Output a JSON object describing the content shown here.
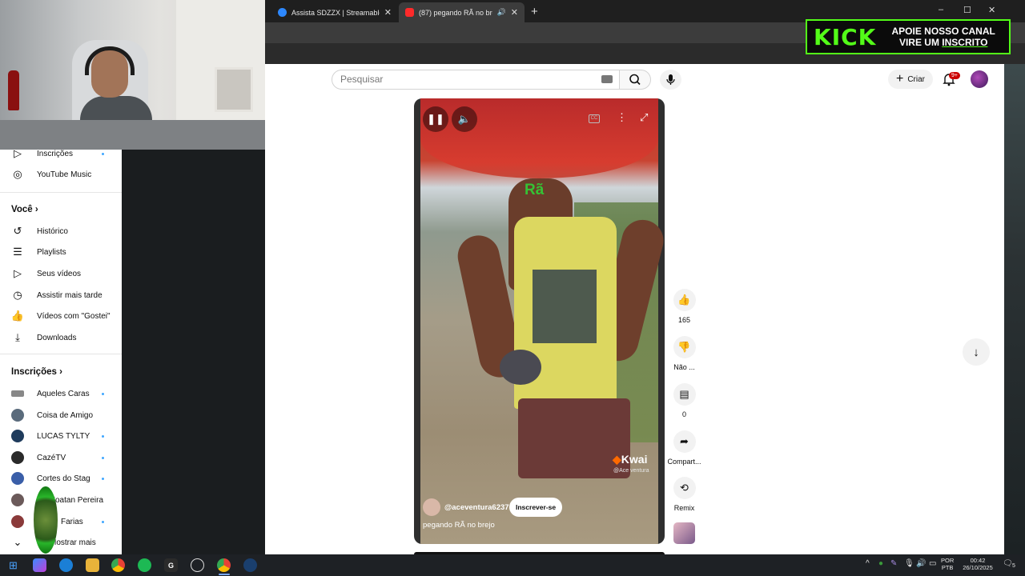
{
  "browser": {
    "tabs": [
      {
        "title": "Assista SDZZX | Streamable",
        "active": false
      },
      {
        "title": "(87) pegando RÃ no brejo",
        "active": true
      }
    ],
    "new_tab": "+",
    "window_controls": [
      "–",
      "☐",
      "✕"
    ]
  },
  "kick_banner": {
    "logo": "KICK",
    "line1": "APOIE NOSSO CANAL",
    "line2_a": "VIRE UM ",
    "line2_b": "INSCRITO",
    "accent": "#53fc18"
  },
  "header": {
    "search_placeholder": "Pesquisar",
    "create_label": "Criar",
    "notification_count": "9+"
  },
  "sidebar": {
    "top_items": [
      {
        "label": "Inscrições",
        "icon": "subscriptions-icon",
        "dot": true
      },
      {
        "label": "YouTube Music",
        "icon": "music-icon",
        "dot": false
      }
    ],
    "you_heading": "Você",
    "you_items": [
      {
        "label": "Histórico",
        "icon": "history-icon"
      },
      {
        "label": "Playlists",
        "icon": "playlist-icon"
      },
      {
        "label": "Seus vídeos",
        "icon": "your-videos-icon"
      },
      {
        "label": "Assistir mais tarde",
        "icon": "clock-icon"
      },
      {
        "label": "Vídeos com \"Gostei\"",
        "icon": "like-icon"
      },
      {
        "label": "Downloads",
        "icon": "download-icon"
      }
    ],
    "subs_heading": "Inscrições",
    "subs": [
      {
        "label": "Aqueles Caras",
        "dot": true,
        "color": "#888888"
      },
      {
        "label": "Coisa de Amigo",
        "dot": false,
        "color": "#5a6b7c"
      },
      {
        "label": "LUCAS TYLTY",
        "dot": true,
        "color": "#1f3b5c"
      },
      {
        "label": "CazéTV",
        "dot": true,
        "color": "#2a2a2a"
      },
      {
        "label": "Cortes do Stag",
        "dot": true,
        "color": "#3a5ea8"
      },
      {
        "label": "Joatan Pereira",
        "dot": false,
        "color": "#6b5a5a"
      },
      {
        "label": "Farias",
        "dot": true,
        "color": "#8a3a3a"
      }
    ],
    "show_more": "Mostrar mais"
  },
  "video": {
    "overlay_text": "Rã",
    "watermark": "Kwai",
    "watermark_sub": "@Ace ventura",
    "channel": "@aceventura6237",
    "subscribe_label": "Inscrever-se",
    "title": "pegando RÃ no brejo",
    "cc": "CC"
  },
  "actions": [
    {
      "label": "165",
      "icon": "thumbs-up-icon"
    },
    {
      "label": "Não ...",
      "icon": "thumbs-down-icon"
    },
    {
      "label": "0",
      "icon": "comment-icon"
    },
    {
      "label": "Compart...",
      "icon": "share-icon"
    },
    {
      "label": "Remix",
      "icon": "remix-icon"
    }
  ],
  "taskbar": {
    "lang_line1": "POR",
    "lang_line2": "PTB",
    "time": "00:42",
    "date": "26/10/2025",
    "notif": "5"
  }
}
